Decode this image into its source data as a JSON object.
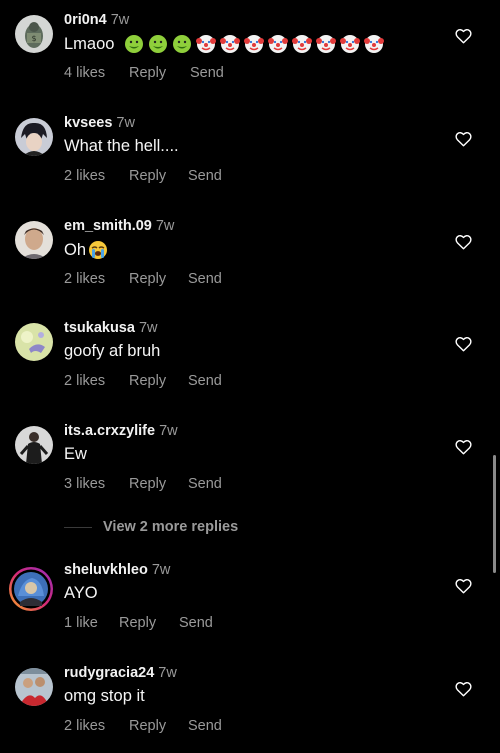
{
  "comments": [
    {
      "username": "0ri0n4",
      "time": "7w",
      "text": "Lmaoo",
      "emojis": [
        "nauseated-face",
        "nauseated-face",
        "nauseated-face",
        "clown-face",
        "clown-face",
        "clown-face",
        "clown-face",
        "clown-face",
        "clown-face",
        "clown-face"
      ],
      "likes": "4 likes",
      "reply": "Reply",
      "send": "Send"
    },
    {
      "username": "kvsees",
      "time": "7w",
      "text": "What the hell....",
      "emojis": [],
      "likes": "2 likes",
      "reply": "Reply",
      "send": "Send"
    },
    {
      "username": "em_smith.09",
      "time": "7w",
      "text": "Oh",
      "emojis": [
        "loudly-crying-face"
      ],
      "likes": "2 likes",
      "reply": "Reply",
      "send": "Send"
    },
    {
      "username": "tsukakusa",
      "time": "7w",
      "text": "goofy af bruh",
      "emojis": [],
      "likes": "2 likes",
      "reply": "Reply",
      "send": "Send"
    },
    {
      "username": "its.a.crxzylife",
      "time": "7w",
      "text": "Ew",
      "emojis": [],
      "likes": "3 likes",
      "reply": "Reply",
      "send": "Send"
    },
    {
      "username": "sheluvkhleo",
      "time": "7w",
      "text": "AYO",
      "emojis": [],
      "likes": "1 like",
      "reply": "Reply",
      "send": "Send"
    },
    {
      "username": "rudygracia24",
      "time": "7w",
      "text": "omg stop it",
      "emojis": [],
      "likes": "2 likes",
      "reply": "Reply",
      "send": "Send"
    }
  ],
  "view_more_replies": "View 2 more replies",
  "colors": {
    "background": "#000000",
    "muted_text": "#9a9a9a",
    "story_ring": "#d62976"
  },
  "icons": {
    "like": "heart-outline-icon"
  }
}
